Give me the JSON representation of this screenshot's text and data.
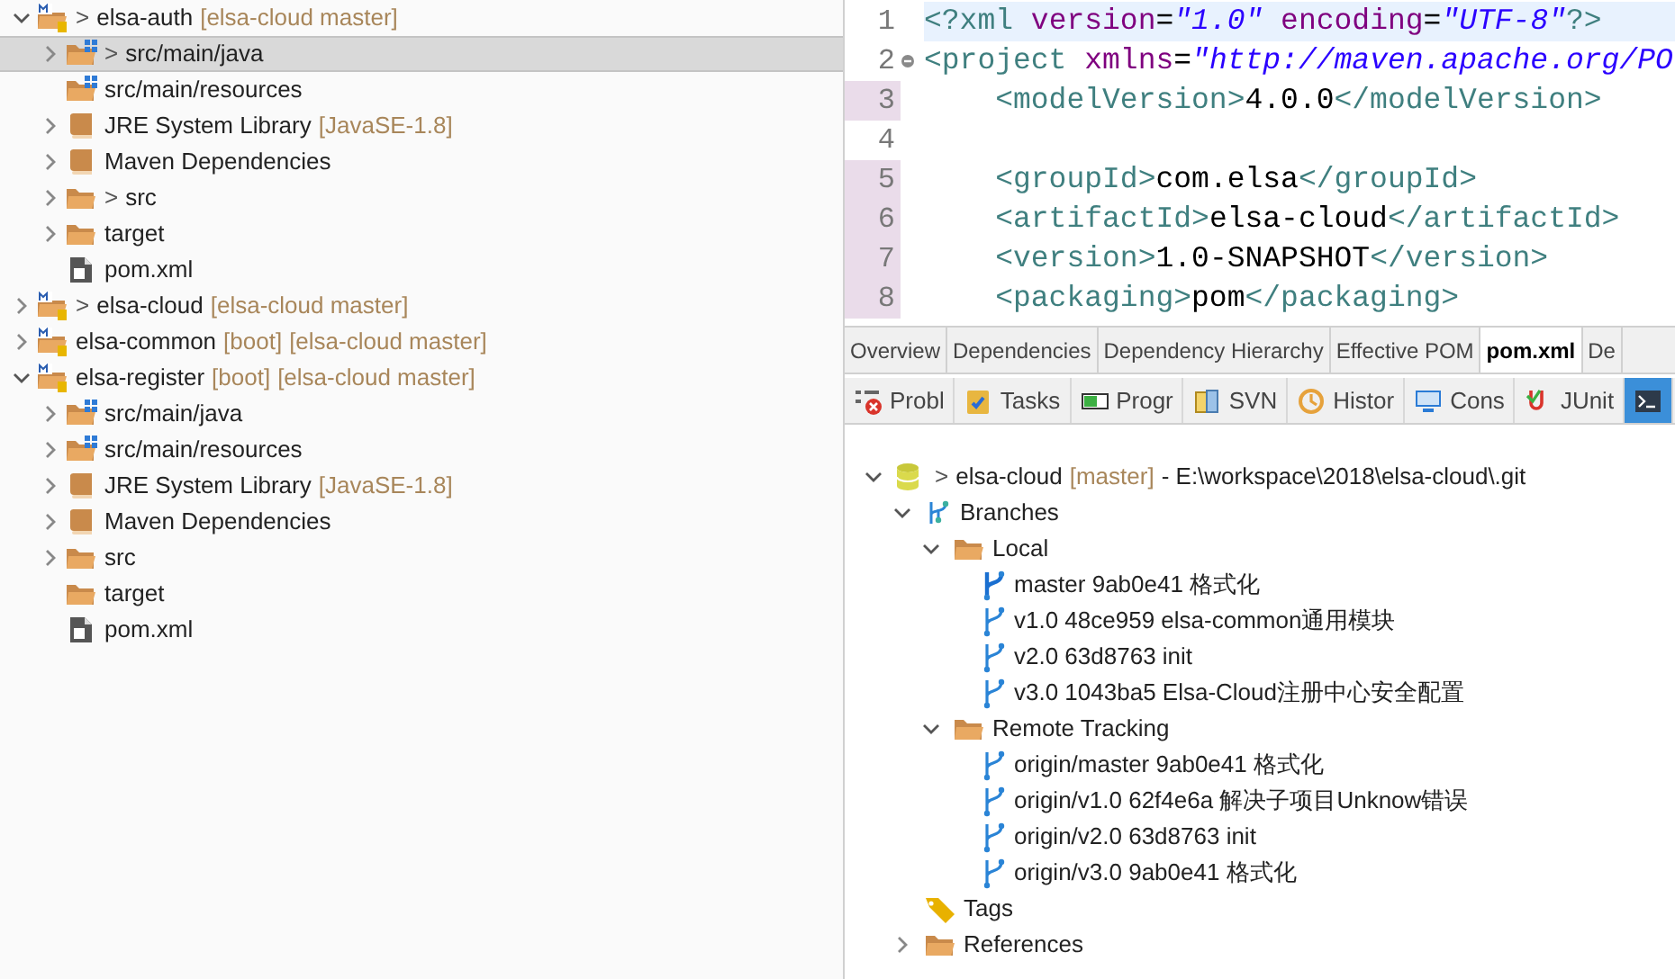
{
  "project_explorer": {
    "items": [
      {
        "kind": "project",
        "prefix": ">",
        "label": "elsa-auth",
        "decorations": [
          "[elsa-cloud master]"
        ],
        "expanded": true,
        "selected": false,
        "children": [
          {
            "kind": "source-folder",
            "prefix": ">",
            "label": "src/main/java",
            "expanded": false,
            "selected": true
          },
          {
            "kind": "source-folder",
            "label": "src/main/resources",
            "selected": false
          },
          {
            "kind": "library",
            "label": "JRE System Library",
            "decorations": [
              "[JavaSE-1.8]"
            ],
            "expanded": false,
            "selected": false
          },
          {
            "kind": "library",
            "label": "Maven Dependencies",
            "expanded": false,
            "selected": false
          },
          {
            "kind": "folder",
            "prefix": ">",
            "label": "src",
            "expanded": false,
            "selected": false
          },
          {
            "kind": "folder",
            "label": "target",
            "expanded": false,
            "selected": false
          },
          {
            "kind": "file",
            "label": "pom.xml",
            "selected": false
          }
        ]
      },
      {
        "kind": "project",
        "prefix": ">",
        "label": "elsa-cloud",
        "decorations": [
          "[elsa-cloud master]"
        ],
        "expanded": false,
        "selected": false
      },
      {
        "kind": "project",
        "label": "elsa-common",
        "decorations": [
          "[boot]",
          "[elsa-cloud master]"
        ],
        "expanded": false,
        "selected": false
      },
      {
        "kind": "project",
        "label": "elsa-register",
        "decorations": [
          "[boot]",
          "[elsa-cloud master]"
        ],
        "expanded": true,
        "selected": false,
        "children": [
          {
            "kind": "source-folder",
            "label": "src/main/java",
            "expanded": false,
            "selected": false
          },
          {
            "kind": "source-folder",
            "label": "src/main/resources",
            "expanded": false,
            "selected": false
          },
          {
            "kind": "library",
            "label": "JRE System Library",
            "decorations": [
              "[JavaSE-1.8]"
            ],
            "expanded": false,
            "selected": false
          },
          {
            "kind": "library",
            "label": "Maven Dependencies",
            "expanded": false,
            "selected": false
          },
          {
            "kind": "folder",
            "label": "src",
            "expanded": false,
            "selected": false
          },
          {
            "kind": "folder",
            "label": "target",
            "selected": false
          },
          {
            "kind": "file",
            "label": "pom.xml",
            "selected": false
          }
        ]
      }
    ]
  },
  "editor": {
    "lines": [
      {
        "number": "1",
        "current": true,
        "changed": false,
        "tokens": [
          {
            "kind": "tag",
            "text": "<?xml "
          },
          {
            "kind": "attr",
            "text": "version"
          },
          {
            "kind": "text",
            "text": "="
          },
          {
            "kind": "value",
            "text": "\"1.0\""
          },
          {
            "kind": "attr",
            "text": " encoding"
          },
          {
            "kind": "text",
            "text": "="
          },
          {
            "kind": "value",
            "text": "\"UTF-8\""
          },
          {
            "kind": "tag",
            "text": "?>"
          }
        ]
      },
      {
        "number": "2",
        "current": false,
        "changed": false,
        "fold": true,
        "tokens": [
          {
            "kind": "tag",
            "text": "<project "
          },
          {
            "kind": "attr",
            "text": "xmlns"
          },
          {
            "kind": "text",
            "text": "="
          },
          {
            "kind": "value",
            "text": "\"http://maven.apache.org/PO"
          }
        ]
      },
      {
        "number": "3",
        "current": false,
        "changed": true,
        "tokens": [
          {
            "kind": "tag",
            "text": "    <modelVersion>"
          },
          {
            "kind": "text",
            "text": "4.0.0"
          },
          {
            "kind": "tag",
            "text": "</modelVersion>"
          }
        ]
      },
      {
        "number": "4",
        "current": false,
        "changed": false
      },
      {
        "number": "5",
        "current": false,
        "changed": true,
        "tokens": [
          {
            "kind": "tag",
            "text": "    <groupId>"
          },
          {
            "kind": "text",
            "text": "com.elsa"
          },
          {
            "kind": "tag",
            "text": "</groupId>"
          }
        ]
      },
      {
        "number": "6",
        "current": false,
        "changed": true,
        "tokens": [
          {
            "kind": "tag",
            "text": "    <artifactId>"
          },
          {
            "kind": "text",
            "text": "elsa-cloud"
          },
          {
            "kind": "tag",
            "text": "</artifactId>"
          }
        ]
      },
      {
        "number": "7",
        "current": false,
        "changed": true,
        "tokens": [
          {
            "kind": "tag",
            "text": "    <version>"
          },
          {
            "kind": "text",
            "text": "1.0-SNAPSHOT"
          },
          {
            "kind": "tag",
            "text": "</version>"
          }
        ]
      },
      {
        "number": "8",
        "current": false,
        "changed": true,
        "tokens": [
          {
            "kind": "tag",
            "text": "    <packaging>"
          },
          {
            "kind": "text",
            "text": "pom"
          },
          {
            "kind": "tag",
            "text": "</packaging>"
          }
        ]
      }
    ]
  },
  "editor_tabs": [
    {
      "label": "Overview",
      "selected": false
    },
    {
      "label": "Dependencies",
      "selected": false
    },
    {
      "label": "Dependency Hierarchy",
      "selected": false
    },
    {
      "label": "Effective POM",
      "selected": false
    },
    {
      "label": "pom.xml",
      "selected": true
    },
    {
      "label": "De",
      "selected": false
    }
  ],
  "views": [
    {
      "kind": "problems",
      "label": "Probl",
      "selected": false
    },
    {
      "kind": "tasks",
      "label": "Tasks",
      "selected": false
    },
    {
      "kind": "progress",
      "label": "Progr",
      "selected": false
    },
    {
      "kind": "svn",
      "label": "SVN",
      "selected": false
    },
    {
      "kind": "history",
      "label": "Histor",
      "selected": false
    },
    {
      "kind": "console",
      "label": "Cons",
      "selected": false
    },
    {
      "kind": "junit",
      "label": "JUnit",
      "selected": false
    },
    {
      "kind": "terminal",
      "selected": true
    }
  ],
  "git_repositories": {
    "items": [
      {
        "kind": "repository",
        "prefix": ">",
        "label": "elsa-cloud",
        "decorations": [
          "[master]"
        ],
        "suffix": "- E:\\workspace\\2018\\elsa-cloud\\.git",
        "expanded": true,
        "children": [
          {
            "kind": "branches",
            "label": "Branches",
            "expanded": true,
            "children": [
              {
                "kind": "folder",
                "label": "Local",
                "expanded": true,
                "children": [
                  {
                    "kind": "branch",
                    "label": "master 9ab0e41 格式化",
                    "head": true
                  },
                  {
                    "kind": "branch",
                    "label": "v1.0 48ce959 elsa-common通用模块",
                    "head": false
                  },
                  {
                    "kind": "branch",
                    "label": "v2.0 63d8763 init",
                    "head": false
                  },
                  {
                    "kind": "branch",
                    "label": "v3.0 1043ba5 Elsa-Cloud注册中心安全配置",
                    "head": false
                  }
                ]
              },
              {
                "kind": "folder",
                "label": "Remote Tracking",
                "expanded": true,
                "children": [
                  {
                    "kind": "branch",
                    "label": "origin/master 9ab0e41 格式化",
                    "head": false
                  },
                  {
                    "kind": "branch",
                    "label": "origin/v1.0 62f4e6a 解决子项目Unknow错误",
                    "head": false
                  },
                  {
                    "kind": "branch",
                    "label": "origin/v2.0 63d8763 init",
                    "head": false
                  },
                  {
                    "kind": "branch",
                    "label": "origin/v3.0 9ab0e41 格式化",
                    "head": false
                  }
                ]
              }
            ]
          },
          {
            "kind": "tags",
            "label": "Tags"
          },
          {
            "kind": "folder",
            "label": "References",
            "expanded": false
          }
        ]
      }
    ]
  }
}
